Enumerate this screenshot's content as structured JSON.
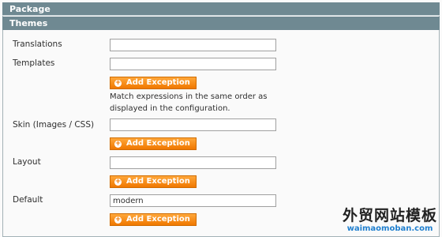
{
  "sections": {
    "package": "Package",
    "themes": "Themes"
  },
  "fields": {
    "translations": {
      "label": "Translations",
      "value": ""
    },
    "templates": {
      "label": "Templates",
      "value": ""
    },
    "skin": {
      "label": "Skin (Images / CSS)",
      "value": ""
    },
    "layout": {
      "label": "Layout",
      "value": ""
    },
    "default": {
      "label": "Default",
      "value": "modern"
    }
  },
  "buttons": {
    "add_exception": "Add Exception"
  },
  "note": "Match expressions in the same order as displayed in the configuration.",
  "watermark": {
    "chinese": "外贸网站模板",
    "url": "waimaomoban.com"
  },
  "colors": {
    "header_bg": "#6f8992",
    "button_orange": "#f07800"
  }
}
